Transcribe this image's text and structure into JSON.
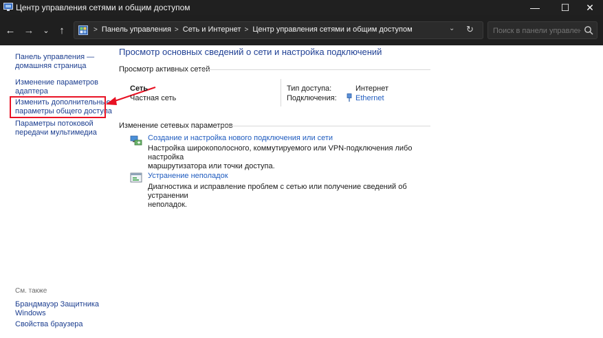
{
  "window": {
    "title": "Центр управления сетями и общим доступом",
    "min_glyph": "—",
    "max_glyph": "☐",
    "close_glyph": "✕"
  },
  "nav": {
    "back_glyph": "←",
    "forward_glyph": "→",
    "recent_glyph": "⌄",
    "up_glyph": "↑",
    "breadcrumb": [
      "Панель управления",
      "Сеть и Интернет",
      "Центр управления сетями и общим доступом"
    ],
    "breadcrumb_sep": ">",
    "dropdown_glyph": "⌄",
    "refresh_glyph": "↻",
    "search_placeholder": "Поиск в панели управления"
  },
  "sidebar": {
    "items": [
      {
        "line1": "Панель управления —",
        "line2": "домашняя страница"
      },
      {
        "line1": "Изменение параметров",
        "line2": "адаптера"
      },
      {
        "line1": "Изменить дополнительные",
        "line2": "параметры общего доступа"
      },
      {
        "line1": "Параметры потоковой",
        "line2": "передачи мультимедиа"
      }
    ],
    "see_also_label": "См. также",
    "see_also": [
      {
        "line1": "Брандмауэр Защитника",
        "line2": "Windows"
      },
      {
        "line1": "Свойства браузера",
        "line2": ""
      }
    ]
  },
  "main": {
    "title": "Просмотр основных сведений о сети и настройка подключений",
    "active_networks_heading": "Просмотр активных сетей",
    "network": {
      "name": "Сеть",
      "type": "Частная сеть",
      "access_label": "Тип доступа:",
      "access_value": "Интернет",
      "connections_label": "Подключения:",
      "connections_value": "Ethernet"
    },
    "change_heading": "Изменение сетевых параметров",
    "tasks": [
      {
        "link": "Создание и настройка нового подключения или сети",
        "desc1": "Настройка широкополосного, коммутируемого или VPN-подключения либо настройка",
        "desc2": "маршрутизатора или точки доступа."
      },
      {
        "link": "Устранение неполадок",
        "desc1": "Диагностика и исправление проблем с сетью или получение сведений об устранении",
        "desc2": "неполадок."
      }
    ]
  },
  "colors": {
    "titlebar": "#202020",
    "link": "#1e5bbf",
    "sidebar_link": "#1b3d8f",
    "highlight": "#e81123"
  }
}
